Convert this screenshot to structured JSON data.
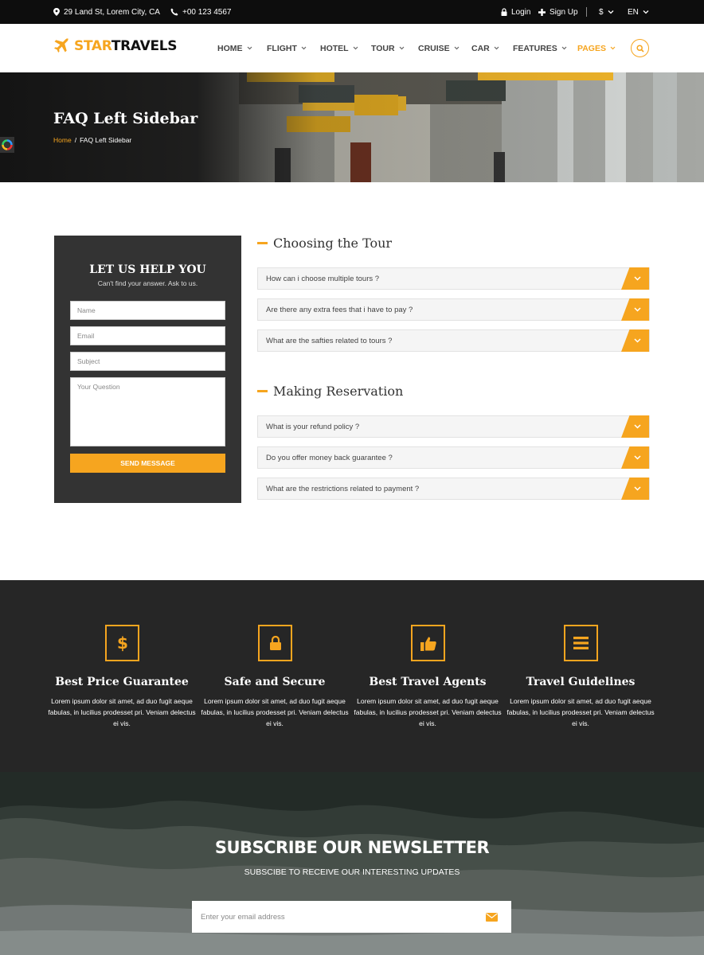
{
  "colors": {
    "accent": "#f6a51f",
    "topbar_bg": "#0d0d0d",
    "dark_panel": "#333333",
    "features_bg": "#262626"
  },
  "topbar": {
    "address": "29 Land St, Lorem City, CA",
    "phone": "+00 123 4567",
    "login": "Login",
    "signup": "Sign Up",
    "currency": "$",
    "language": "EN",
    "icons": [
      "map-pin-icon",
      "phone-icon",
      "lock-icon",
      "plus-icon",
      "chevron-down-icon"
    ]
  },
  "logo": {
    "part1": "STAR",
    "part2": "TRAVELS",
    "icon": "airplane-icon"
  },
  "nav": {
    "items": [
      {
        "label": "HOME"
      },
      {
        "label": "FLIGHT"
      },
      {
        "label": "HOTEL"
      },
      {
        "label": "TOUR"
      },
      {
        "label": "CRUISE"
      },
      {
        "label": "CAR"
      },
      {
        "label": "FEATURES"
      },
      {
        "label": "PAGES",
        "active": true
      }
    ],
    "search_icon": "search-icon"
  },
  "hero": {
    "title": "FAQ Left Sidebar",
    "breadcrumb_home": "Home",
    "breadcrumb_sep": "/",
    "breadcrumb_current": "FAQ Left Sidebar"
  },
  "help": {
    "title": "LET US HELP YOU",
    "subtitle": "Can't find your answer. Ask to us.",
    "name_placeholder": "Name",
    "email_placeholder": "Email",
    "subject_placeholder": "Subject",
    "question_placeholder": "Your Question",
    "button": "SEND MESSAGE"
  },
  "faq": {
    "sections": [
      {
        "title": "Choosing the Tour",
        "questions": [
          "How can i choose multiple tours ?",
          "Are there any extra fees that i have to pay ?",
          "What are the safties related to tours ?"
        ]
      },
      {
        "title": "Making Reservation",
        "questions": [
          "What is your refund policy ?",
          "Do you offer money back guarantee ?",
          "What are the restrictions related to payment ?"
        ]
      }
    ]
  },
  "features": [
    {
      "icon": "dollar-icon",
      "title": "Best Price Guarantee",
      "text": "Lorem ipsum dolor sit amet, ad duo fugit aeque fabulas, in lucilius prodesset pri. Veniam delectus ei vis."
    },
    {
      "icon": "lock-icon",
      "title": "Safe and Secure",
      "text": "Lorem ipsum dolor sit amet, ad duo fugit aeque fabulas, in lucilius prodesset pri. Veniam delectus ei vis."
    },
    {
      "icon": "thumbs-up-icon",
      "title": "Best Travel Agents",
      "text": "Lorem ipsum dolor sit amet, ad duo fugit aeque fabulas, in lucilius prodesset pri. Veniam delectus ei vis."
    },
    {
      "icon": "menu-lines-icon",
      "title": "Travel Guidelines",
      "text": "Lorem ipsum dolor sit amet, ad duo fugit aeque fabulas, in lucilius prodesset pri. Veniam delectus ei vis."
    }
  ],
  "newsletter": {
    "title": "SUBSCRIBE OUR NEWSLETTER",
    "subtitle": "SUBSCIBE TO RECEIVE OUR INTERESTING UPDATES",
    "placeholder": "Enter your email address",
    "submit_icon": "envelope-icon"
  }
}
